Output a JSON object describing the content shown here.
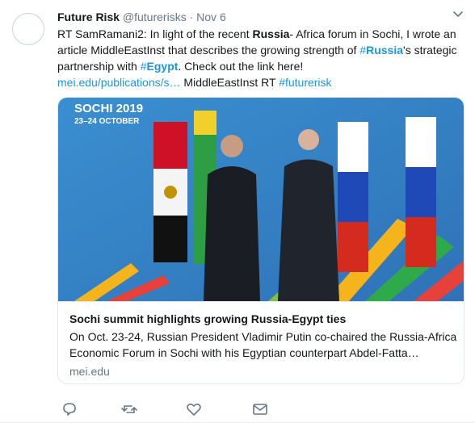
{
  "tweet": {
    "display_name": "Future Risk",
    "handle": "@futurerisks",
    "separator": "·",
    "time": "Nov 6",
    "text_parts": [
      {
        "t": "RT SamRamani2: In light of the recent ",
        "k": "plain"
      },
      {
        "t": "Russia",
        "k": "bold"
      },
      {
        "t": "- Africa forum in Sochi, I wrote an article MiddleEastInst that describes the growing strength of ",
        "k": "plain"
      },
      {
        "t": "#",
        "k": "tag"
      },
      {
        "t": "Russia",
        "k": "tagbold"
      },
      {
        "t": "'s strategic partnership with ",
        "k": "plain"
      },
      {
        "t": "#",
        "k": "tag"
      },
      {
        "t": "Egypt",
        "k": "tagbold"
      },
      {
        "t": ". Check out the link here!",
        "k": "plain"
      },
      {
        "t": "\n",
        "k": "br"
      },
      {
        "t": "mei.edu/publications/s…",
        "k": "link"
      },
      {
        "t": " MiddleEastInst RT ",
        "k": "plain"
      },
      {
        "t": "#futurerisk",
        "k": "tag"
      }
    ]
  },
  "card": {
    "image_text_top": "SOCHI 2019",
    "image_text_dates": "23–24 OCTOBER",
    "title": "Sochi summit highlights growing Russia-Egypt ties",
    "description": "On Oct. 23-24, Russian President Vladimir Putin co-chaired the Russia-Africa Economic Forum in Sochi with his Egyptian counterpart Abdel-Fatta…",
    "domain": "mei.edu"
  },
  "icons": {
    "reply": "reply-icon",
    "retweet": "retweet-icon",
    "like": "heart-icon",
    "message": "envelope-icon",
    "chevron": "chevron-down-icon"
  },
  "colors": {
    "link": "#1b95e0",
    "secondary": "#657786",
    "border": "#e1e8ed"
  }
}
